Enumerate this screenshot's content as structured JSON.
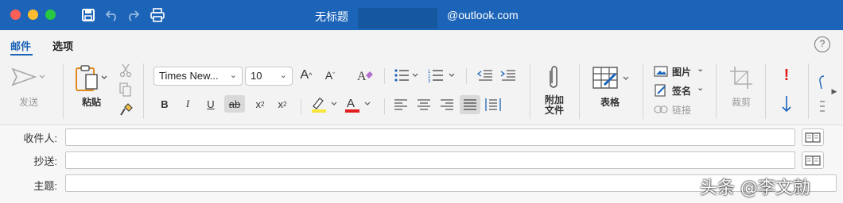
{
  "window": {
    "title": "无标题",
    "account_email": "@outlook.com"
  },
  "tabs": [
    {
      "label": "邮件",
      "active": true
    },
    {
      "label": "选项",
      "active": false
    }
  ],
  "help_label": "?",
  "ribbon": {
    "send_label": "发送",
    "paste_label": "粘贴",
    "font_name": "Times New...",
    "font_size": "10",
    "bold": "B",
    "italic": "I",
    "underline": "U",
    "strikethrough": "ab",
    "subscript": "x",
    "subscript_mark": "2",
    "superscript": "x",
    "superscript_mark": "2",
    "grow_font": "A",
    "shrink_font": "A",
    "font_color_glyph": "A",
    "font_color": "#e11d1d",
    "highlight_color": "#f7e53b",
    "attach_label_line1": "附加",
    "attach_label_line2": "文件",
    "table_label": "表格",
    "picture_label": "图片",
    "signature_label": "签名",
    "link_label": "链接",
    "crop_label": "裁剪",
    "accent_color": "#1b64b8"
  },
  "fields": {
    "to_label": "收件人:",
    "cc_label": "抄送:",
    "subject_label": "主题:",
    "to_value": "",
    "cc_value": "",
    "subject_value": ""
  },
  "watermark": "头条 @李文勍"
}
